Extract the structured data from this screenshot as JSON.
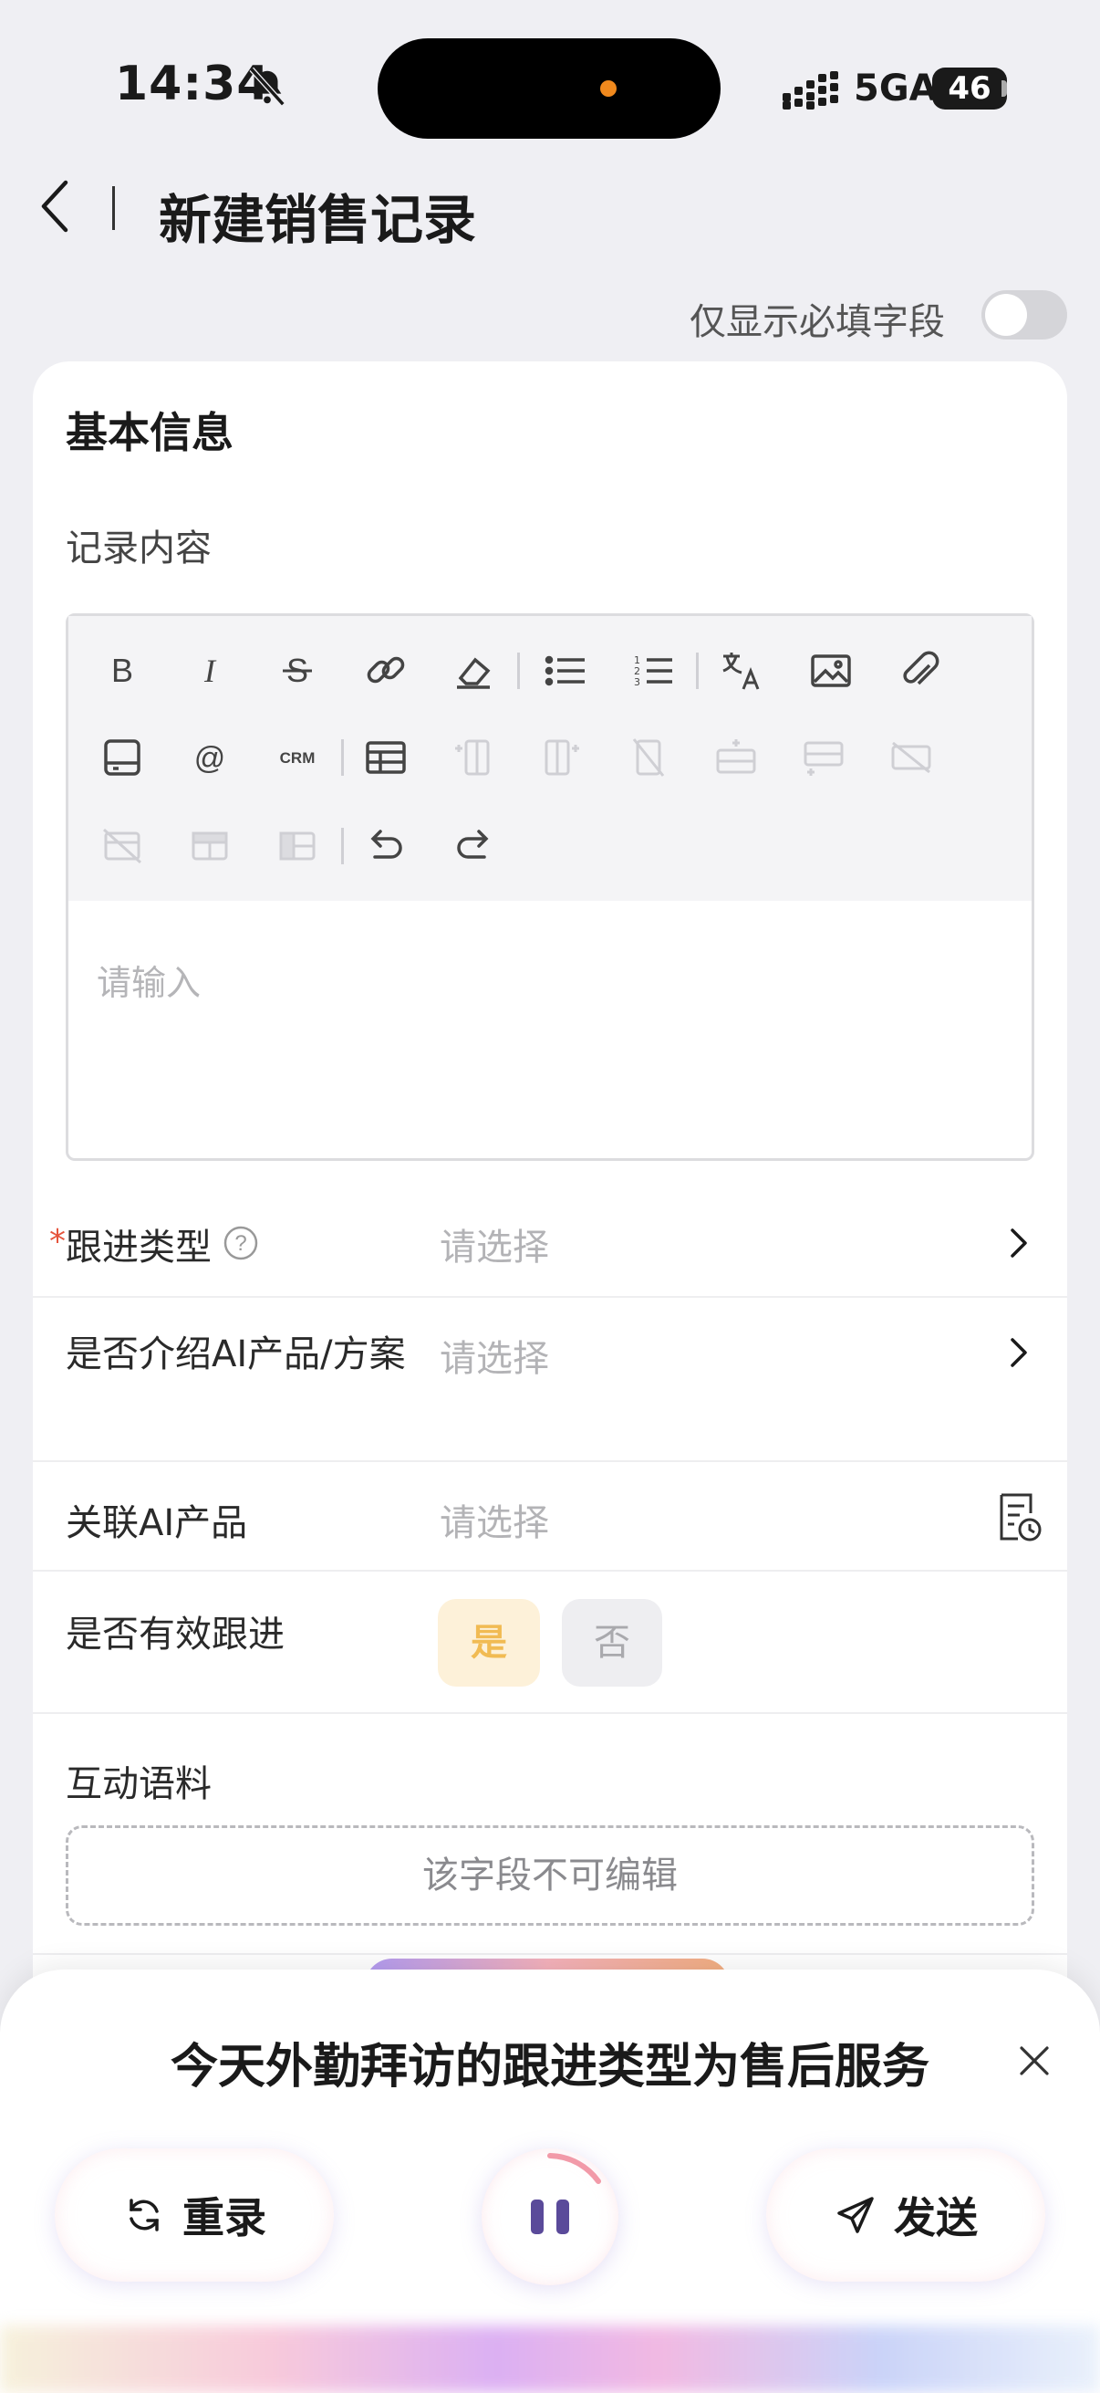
{
  "status_bar": {
    "time": "14:34",
    "network": "5GA",
    "battery": "46",
    "icons": [
      "bell-muted-icon",
      "signal-icon"
    ]
  },
  "header": {
    "title": "新建销售记录",
    "back_icon": "chevron-left-icon"
  },
  "required_toggle": {
    "label": "仅显示必填字段",
    "on": false
  },
  "section": {
    "title": "基本信息"
  },
  "record_content": {
    "label": "记录内容",
    "placeholder": "请输入",
    "toolbar_icons": [
      "bold-icon",
      "italic-icon",
      "strikethrough-icon",
      "link-icon",
      "eraser-icon",
      "bullet-list-icon",
      "numbered-list-icon",
      "translate-icon",
      "image-icon",
      "attachment-icon",
      "card-icon",
      "mention-icon",
      "crm-icon",
      "table-icon",
      "insert-column-left-icon",
      "insert-column-right-icon",
      "delete-column-icon",
      "insert-row-above-icon",
      "insert-row-below-icon",
      "delete-row-icon",
      "delete-table-icon",
      "merge-cells-icon",
      "split-cells-icon",
      "undo-icon",
      "redo-icon"
    ],
    "crm_label": "CRM"
  },
  "fields": {
    "follow_type": {
      "label": "跟进类型",
      "required_mark": "*",
      "placeholder": "请选择"
    },
    "introduce_ai": {
      "label": "是否介绍AI产品/方案",
      "placeholder": "请选择"
    },
    "related_ai": {
      "label": "关联AI产品",
      "placeholder": "请选择"
    },
    "effective_follow": {
      "label": "是否有效跟进",
      "yes": "是",
      "no": "否"
    },
    "interaction": {
      "label": "互动语料",
      "readonly_text": "该字段不可编辑"
    }
  },
  "voice_panel": {
    "transcript": "今天外勤拜访的跟进类型为售后服务",
    "rerecord_label": "重录",
    "send_label": "发送",
    "colors": {
      "accent": "#5a4a9a",
      "star": "#e5543c",
      "yes_text": "#f1bb53"
    }
  }
}
